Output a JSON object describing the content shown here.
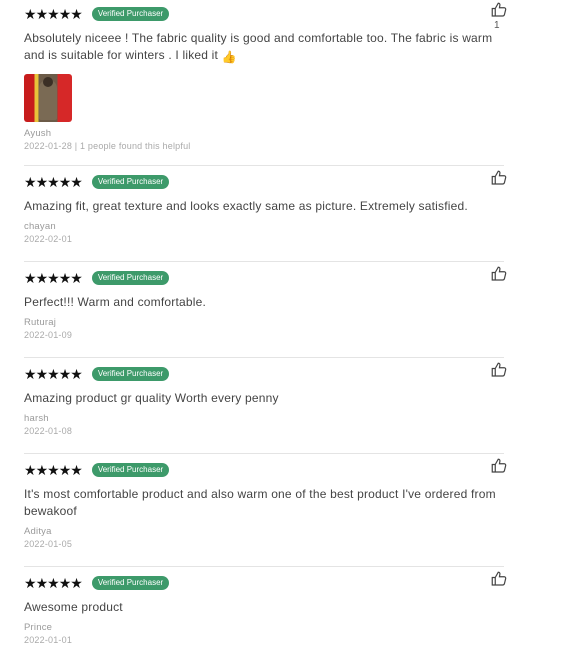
{
  "badge_label": "Verified Purchaser",
  "stars_rating": 5,
  "reviews": [
    {
      "text": "Absolutely niceee ! The fabric quality is good and comfortable too. The fabric is warm and is suitable for winters . I liked it",
      "emoji": "👍",
      "author": "Ayush",
      "date": "2022-01-28",
      "helpful_text": "1 people found this helpful",
      "like_count": "1",
      "has_photo": true
    },
    {
      "text": "Amazing fit, great texture and looks exactly same as picture. Extremely satisfied.",
      "author": "chayan",
      "date": "2022-02-01"
    },
    {
      "text": "Perfect!!! Warm and comfortable.",
      "author": "Ruturaj",
      "date": "2022-01-09"
    },
    {
      "text": "Amazing product gr quality Worth every penny",
      "author": "harsh",
      "date": "2022-01-08"
    },
    {
      "text": "It's most comfortable product and also warm one of the best product I've ordered from bewakoof",
      "author": "Aditya",
      "date": "2022-01-05"
    },
    {
      "text": "Awesome product",
      "author": "Prince",
      "date": "2022-01-01"
    }
  ],
  "icons": {
    "like": "thumbs-up-icon",
    "star": "star-icon"
  },
  "colors": {
    "badge": "#3d9a6a",
    "star": "#111111"
  }
}
